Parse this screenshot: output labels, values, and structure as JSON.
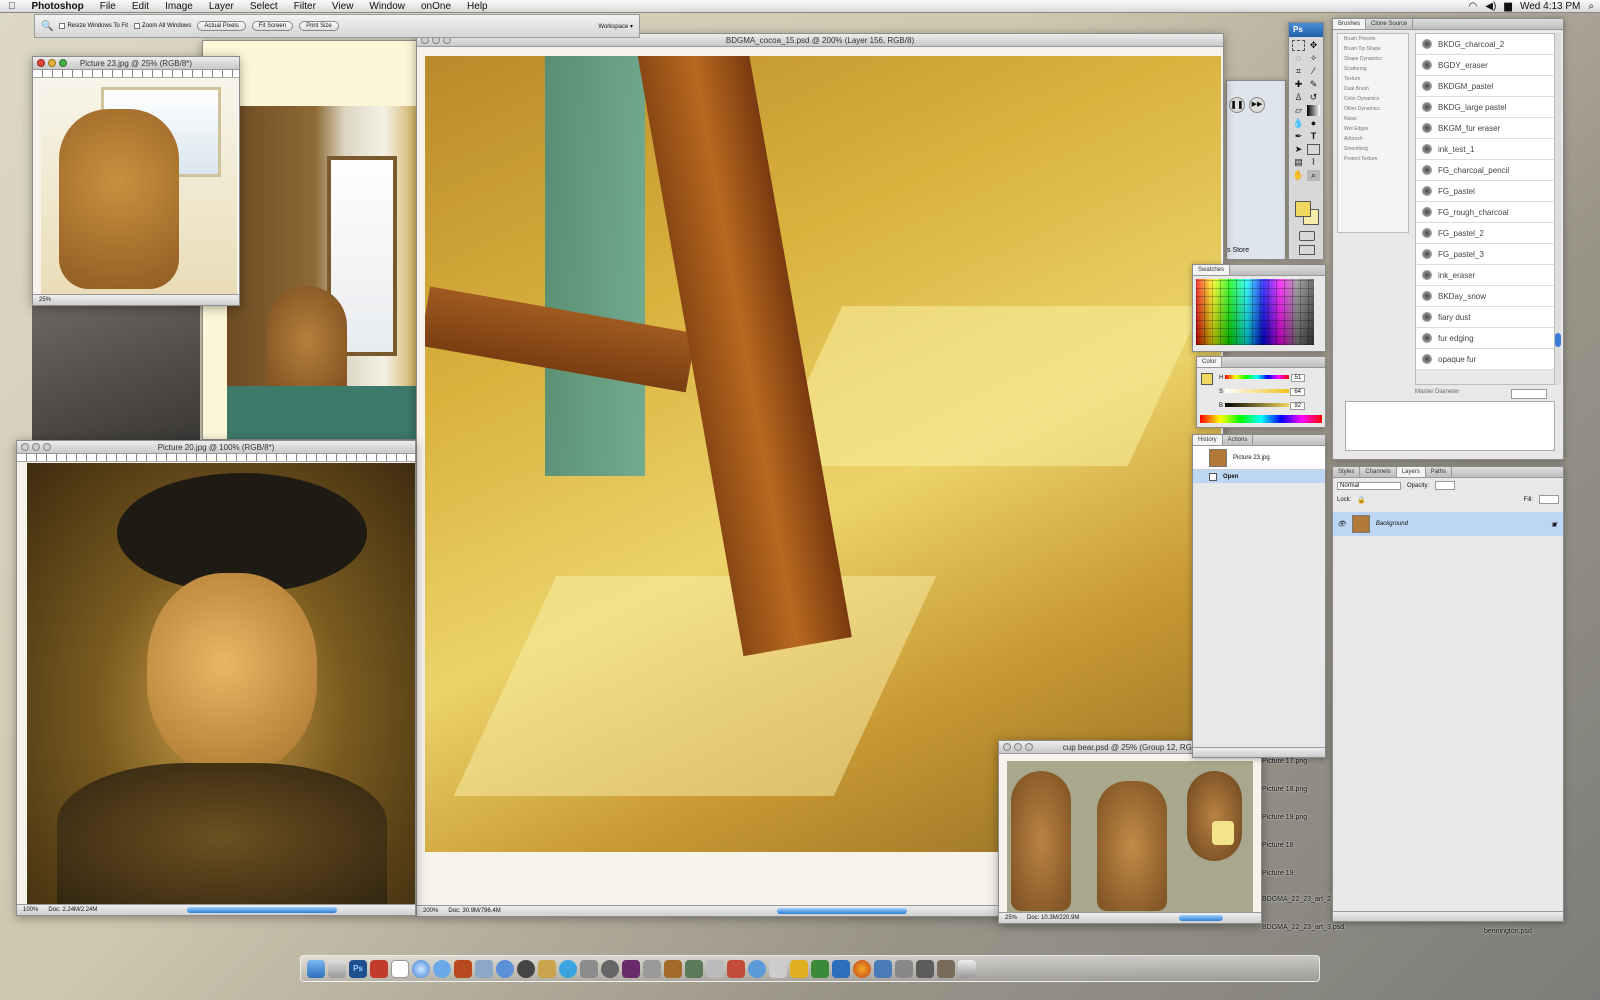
{
  "menubar": {
    "app": "Photoshop",
    "items": [
      "File",
      "Edit",
      "Image",
      "Layer",
      "Select",
      "Filter",
      "View",
      "Window",
      "onOne",
      "Help"
    ],
    "clock": "Wed 4:13 PM"
  },
  "options_bar": {
    "checks": [
      "Resize Windows To Fit",
      "Zoom All Windows"
    ],
    "buttons": [
      "Actual Pixels",
      "Fit Screen",
      "Print Size"
    ],
    "workspace": "Workspace ▾"
  },
  "windows": {
    "main": {
      "title": "BDGMA_cocoa_15.psd @ 200% (Layer 156, RGB/8)",
      "zoom": "200%",
      "doc": "Doc: 30.9M/796.4M"
    },
    "picture23": {
      "title": "Picture 23.jpg @ 25% (RGB/8*)",
      "zoom": "25%"
    },
    "picture20": {
      "title": "Picture 20.jpg @ 100% (RGB/8*)",
      "zoom": "100%",
      "doc": "Doc: 2.24M/2.24M"
    },
    "cupbear": {
      "title": "cup bear.psd @ 25% (Group 12, RGB",
      "zoom": "25%",
      "doc": "Doc: 10.3M/220.9M"
    }
  },
  "panels": {
    "brushes_tabs": [
      "Brushes",
      "Clone Source"
    ],
    "brush_options": [
      "Brush Presets",
      "Brush Tip Shape",
      "Shape Dynamics",
      "Scattering",
      "Texture",
      "Dual Brush",
      "Color Dynamics",
      "Other Dynamics",
      "Noise",
      "Wet Edges",
      "Airbrush",
      "Smoothing",
      "Protect Texture"
    ],
    "brush_presets": [
      "BKDG_charcoal_2",
      "BGDY_eraser",
      "BKDGM_pastel",
      "BKDG_large pastel",
      "BKGM_fur eraser",
      "ink_test_1",
      "FG_charcoal_pencil",
      "FG_pastel",
      "FG_rough_charcoal",
      "FG_pastel_2",
      "FG_pastel_3",
      "ink_eraser",
      "BKDay_snow",
      "fiary dust",
      "fur edging",
      "opaque fur"
    ],
    "master_diameter": "Master Diameter",
    "swatches_tab": "Swatches",
    "color_tab": "Color",
    "color_hsb": {
      "H": "51",
      "S": "64",
      "B": "92"
    },
    "history_tabs": [
      "History",
      "Actions"
    ],
    "history_items": [
      "Picture 23.jpg",
      "Open"
    ],
    "layers_tabs": [
      "Styles",
      "Channels",
      "Layers",
      "Paths"
    ],
    "blend_mode": "Normal",
    "opacity_label": "Opacity:",
    "lock_label": "Lock:",
    "fill_label": "Fill:",
    "layer_name": "Background",
    "store_label": "s Store"
  },
  "desktop_files": [
    "Picture 17.png",
    "Picture 18.png",
    "Picture 19.png",
    "Picture 18",
    "Picture 19",
    "BDGMA_22_23_art_2.psd",
    "BDGMA_22_23_art_3.psd",
    "bennington.psd"
  ],
  "colors": {
    "foreground": "#f0d860",
    "accent": "#3a7fd7"
  }
}
